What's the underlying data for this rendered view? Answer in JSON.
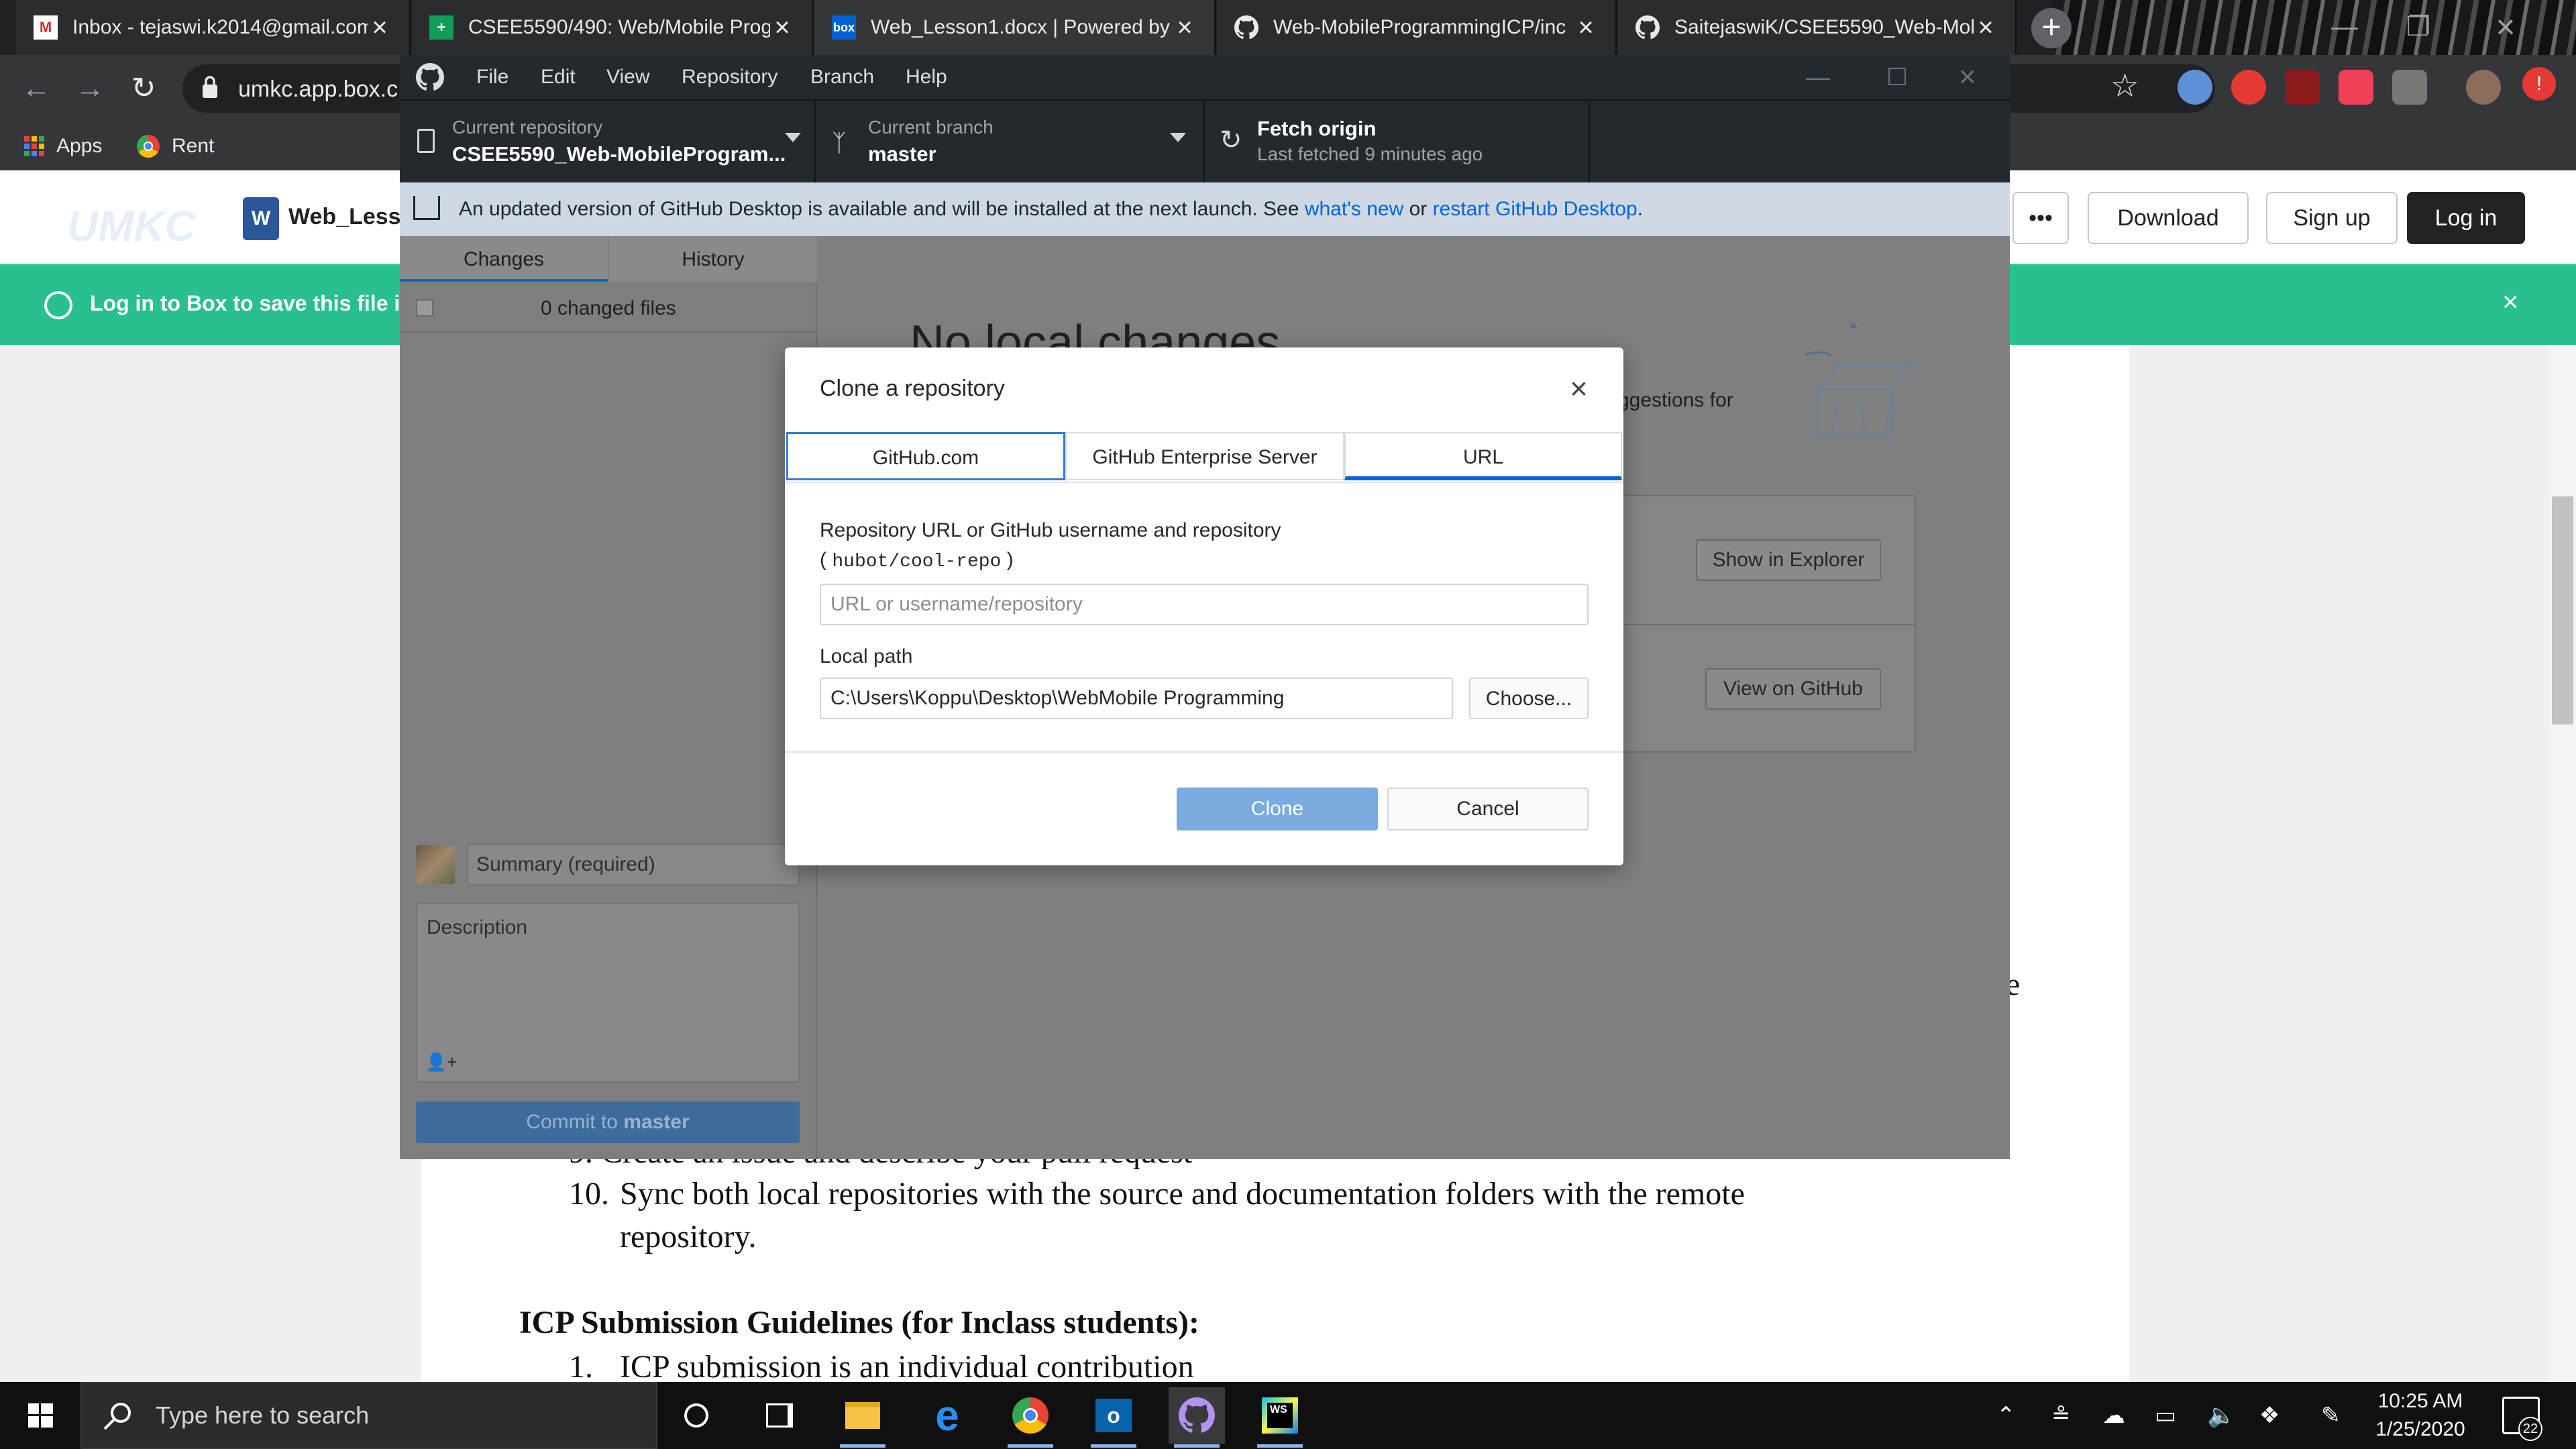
{
  "browser": {
    "tabs": [
      {
        "label": "Inbox - tejaswi.k2014@gmail.com",
        "icon": "gmail-icon"
      },
      {
        "label": "CSEE5590/490: Web/Mobile Prog",
        "icon": "sheets-icon"
      },
      {
        "label": "Web_Lesson1.docx | Powered by",
        "icon": "box-icon"
      },
      {
        "label": "Web-MobileProgrammingICP/inc",
        "icon": "github-icon"
      },
      {
        "label": "SaitejaswiK/CSEE5590_Web-Mob",
        "icon": "github-icon"
      }
    ],
    "tab_close": "×",
    "new_tab": "+",
    "address": "umkc.app.box.c",
    "bookmarks": [
      {
        "label": "Apps",
        "icon": "apps-grid-icon"
      },
      {
        "label": "Rent",
        "icon": "chrome-icon"
      }
    ]
  },
  "box": {
    "logo": "UMKC",
    "doc_icon": "W",
    "doc_name": "Web_Lesso",
    "more": "•••",
    "download": "Download",
    "sign_up": "Sign up",
    "log_in": "Log in",
    "banner": "Log in to Box to save this file i",
    "banner_close": "×",
    "doc_lines": {
      "item9": "9.   Create an issue and describe your pull request",
      "item10_num": "10.",
      "item10_line1": "Sync both local repositories with the source and documentation folders with the remote",
      "item10_line2": "repository.",
      "heading": "ICP Submission Guidelines (for Inclass students):",
      "item1_num": "1.",
      "item1": "ICP submission is an individual contribution",
      "stray_letter": "e"
    }
  },
  "github_desktop": {
    "menu": [
      "File",
      "Edit",
      "View",
      "Repository",
      "Branch",
      "Help"
    ],
    "current_repo_label": "Current repository",
    "current_repo": "CSEE5590_Web-MobileProgram...",
    "current_branch_label": "Current branch",
    "current_branch": "master",
    "fetch_title": "Fetch origin",
    "fetch_sub": "Last fetched 9 minutes ago",
    "update_text": "An updated version of GitHub Desktop is available and will be installed at the next launch. See",
    "update_link1": "what's new",
    "update_or": "or",
    "update_link2": "restart GitHub Desktop",
    "update_end": ".",
    "tab_changes": "Changes",
    "tab_history": "History",
    "changed_files": "0 changed files",
    "summary_placeholder": "Summary (required)",
    "description_placeholder": "Description",
    "commit_prefix": "Commit to",
    "commit_branch": "master",
    "no_local_changes": "No local changes",
    "suggestions_fragment": "ggestions for",
    "show_in_explorer": "Show in Explorer",
    "view_on_github": "View on GitHub"
  },
  "clone_dialog": {
    "title": "Clone a repository",
    "close": "×",
    "tabs": [
      "GitHub.com",
      "GitHub Enterprise Server",
      "URL"
    ],
    "selected_tab": "URL",
    "url_label": "Repository URL or GitHub username and repository",
    "url_hint_open": "(",
    "url_hint_code": "hubot/cool-repo",
    "url_hint_close": ")",
    "url_placeholder": "URL or username/repository",
    "local_path_label": "Local path",
    "local_path_value": "C:\\Users\\Koppu\\Desktop\\WebMobile Programming",
    "choose": "Choose...",
    "clone": "Clone",
    "cancel": "Cancel"
  },
  "taskbar": {
    "search_placeholder": "Type here to search",
    "time": "10:25 AM",
    "date": "1/25/2020",
    "notifications": "22"
  },
  "colors": {
    "chrome_dark": "#202124",
    "github_dark": "#24292e",
    "box_green": "#28c08f",
    "link_blue": "#0366d6",
    "clone_button": "#79aae0"
  }
}
